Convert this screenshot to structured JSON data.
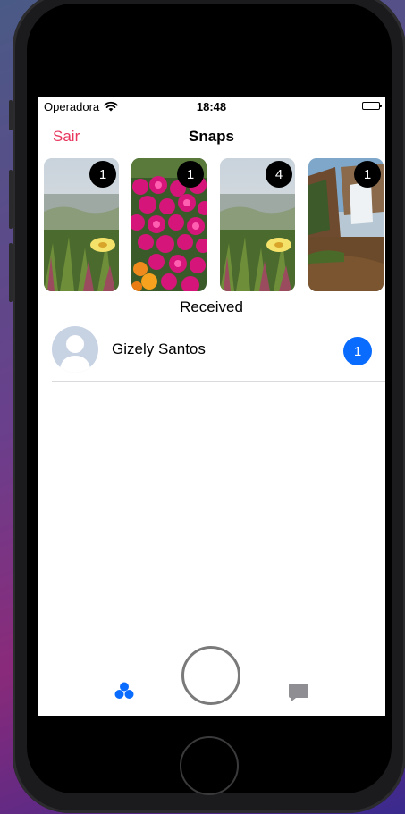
{
  "status_bar": {
    "carrier": "Operadora",
    "time": "18:48"
  },
  "nav": {
    "left_button": "Sair",
    "title": "Snaps"
  },
  "stories": [
    {
      "count": "1",
      "image": "flower-meadow-photo"
    },
    {
      "count": "1",
      "image": "pink-flowers-photo"
    },
    {
      "count": "4",
      "image": "flower-meadow-photo"
    },
    {
      "count": "1",
      "image": "waterfall-photo"
    }
  ],
  "section": {
    "header": "Received"
  },
  "received": [
    {
      "name": "Gizely Santos",
      "count": "1"
    }
  ],
  "tab_bar": {
    "items": [
      "friends-icon",
      "camera-capture-button",
      "chat-icon"
    ],
    "active_color": "#0a6cff",
    "inactive_color": "#8e8e93"
  },
  "colors": {
    "accent_red": "#e8365d",
    "badge_blue": "#0a6cff"
  }
}
